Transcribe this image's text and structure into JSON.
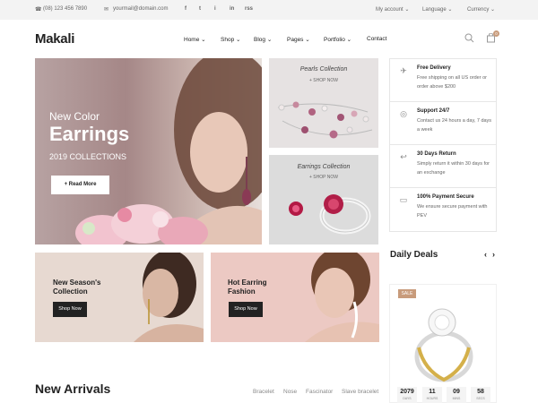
{
  "topbar": {
    "phone": "(08) 123 456 7890",
    "email": "yourmail@domain.com",
    "social": [
      "f",
      "t",
      "i",
      "in",
      "rss"
    ],
    "my_account": "My account",
    "language": "Language",
    "currency": "Currency"
  },
  "header": {
    "logo": "Makali",
    "nav": [
      "Home",
      "Shop",
      "Blog",
      "Pages",
      "Portfolio",
      "Contact"
    ],
    "cart_count": "0"
  },
  "hero": {
    "pre": "New Color",
    "title": "Earrings",
    "sub": "2019 COLLECTIONS",
    "cta": "+ Read More"
  },
  "banners": {
    "pearls_title": "Pearls Collection",
    "pearls_link": "+ SHOP NOW",
    "earrings_title": "Earrings Collection",
    "earrings_link": "+ SHOP NOW",
    "season_title_1": "New Season's",
    "season_title_2": "Collection",
    "season_cta": "Shop Now",
    "hot_title_1": "Hot Earring",
    "hot_title_2": "Fashion",
    "hot_cta": "Shop Now"
  },
  "features": [
    {
      "icon": "plane-icon",
      "title": "Free Delivery",
      "desc": "Free shipping on all US order or order above $200"
    },
    {
      "icon": "lifebuoy-icon",
      "title": "Support 24/7",
      "desc": "Contact us 24 hours a day, 7 days a week"
    },
    {
      "icon": "return-icon",
      "title": "30 Days Return",
      "desc": "Simply return it within 30 days for an exchange"
    },
    {
      "icon": "card-icon",
      "title": "100% Payment Secure",
      "desc": "We ensure secure payment with PEV"
    }
  ],
  "daily_deals": {
    "title": "Daily Deals",
    "badge": "SALE",
    "countdown": [
      {
        "value": "2079",
        "label": "DAYS"
      },
      {
        "value": "11",
        "label": "HOURS"
      },
      {
        "value": "09",
        "label": "MINS"
      },
      {
        "value": "58",
        "label": "SECS"
      }
    ]
  },
  "new_arrivals": {
    "title": "New Arrivals",
    "tabs": [
      "Bracelet",
      "Nose",
      "Fascinator",
      "Slave bracelet"
    ]
  }
}
